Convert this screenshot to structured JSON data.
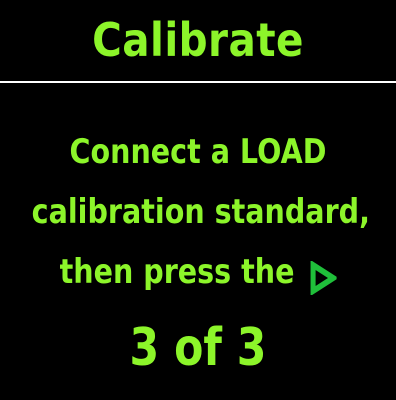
{
  "header": {
    "title": "Calibrate"
  },
  "message": {
    "line1": "Connect a LOAD",
    "line2": "calibration standard,",
    "line3": "then press the"
  },
  "play_icon": {
    "name": "play-icon",
    "color": "#1fbf3a"
  },
  "step": {
    "text": "3 of 3"
  },
  "colors": {
    "background": "#000000",
    "text": "#8cf52a",
    "divider": "#ffffff"
  }
}
